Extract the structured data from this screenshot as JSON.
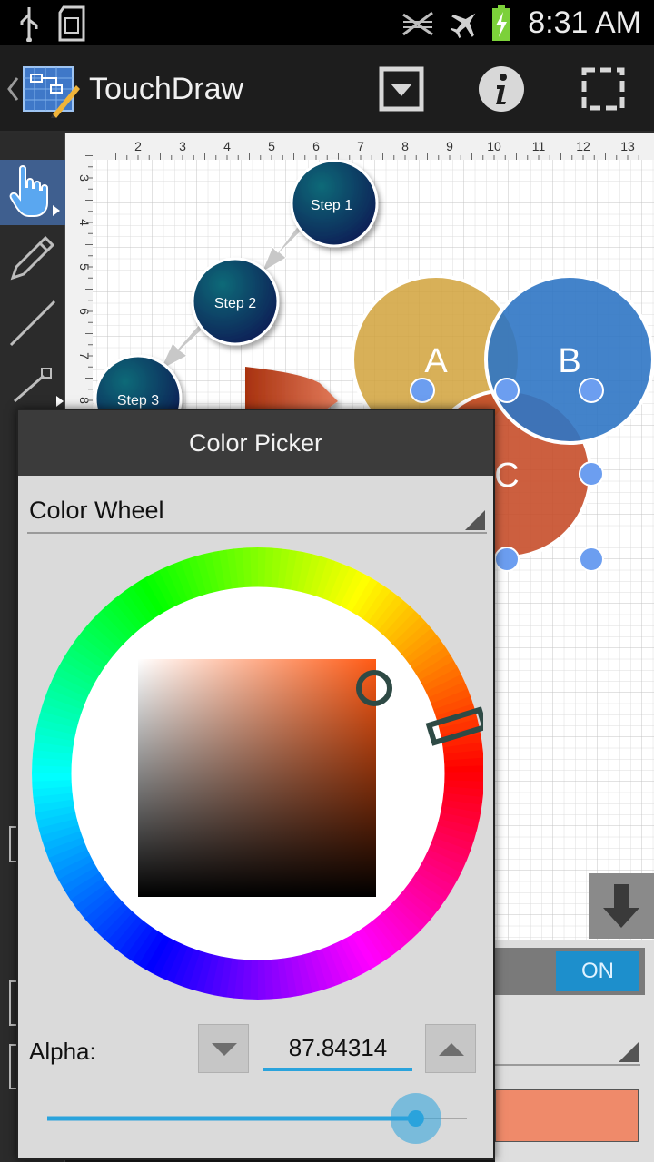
{
  "status_bar": {
    "time": "8:31 AM"
  },
  "app": {
    "title": "TouchDraw"
  },
  "diagram": {
    "ruler_top": [
      "2",
      "3",
      "4",
      "5",
      "6",
      "7",
      "8",
      "9",
      "10",
      "11",
      "12",
      "13"
    ],
    "ruler_left": [
      "3",
      "4",
      "5",
      "6",
      "7",
      "8"
    ],
    "steps": [
      "Step 1",
      "Step 2",
      "Step 3"
    ],
    "circles": {
      "a": "A",
      "b": "B",
      "c": "C"
    },
    "colors": {
      "step_fill": "#0d2d5a",
      "circle_a": "#d1a23b",
      "circle_b": "#2f76c4",
      "circle_c": "#c64e2a",
      "handle": "#6c9ef0"
    }
  },
  "properties_panel": {
    "toggle_label": "ON",
    "fill_color": "#ef8a6a"
  },
  "color_picker": {
    "title": "Color Picker",
    "mode": "Color Wheel",
    "alpha_label": "Alpha:",
    "alpha_value": "87.84314",
    "alpha_fraction": 0.8784,
    "hue_color": "#ff5a14",
    "accent": "#2aa3dc"
  }
}
